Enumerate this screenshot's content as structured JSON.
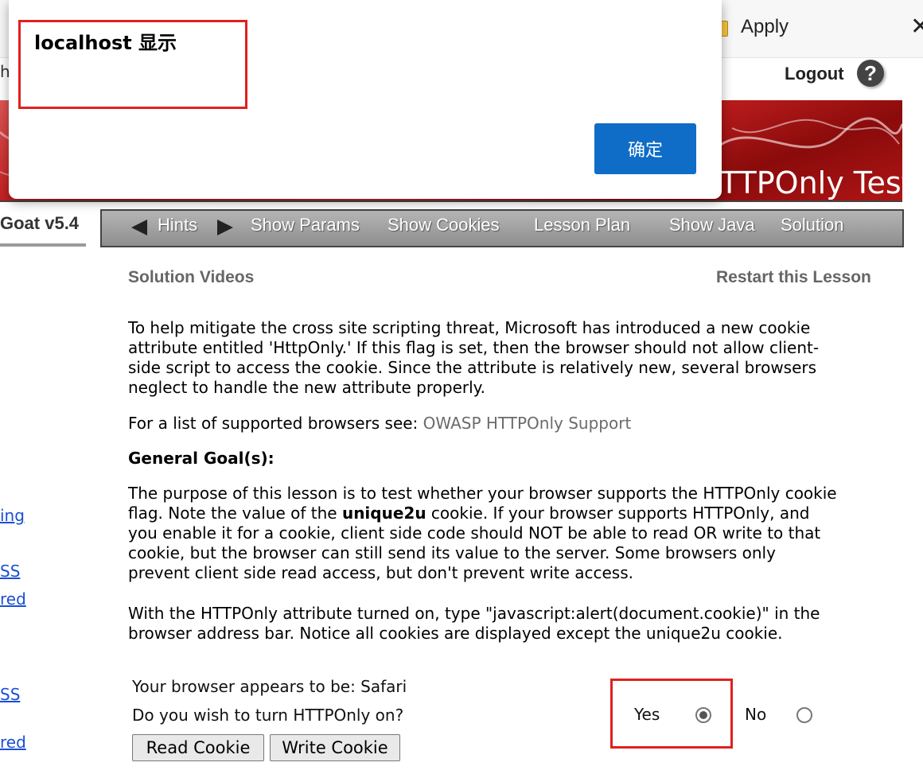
{
  "browser": {
    "apply_label": "Apply",
    "close_glyph": "✕"
  },
  "partial_left_text": "ho",
  "header": {
    "logout_label": "Logout",
    "help_glyph": "?"
  },
  "banner": {
    "title": "TTPOnly Test"
  },
  "brand": "Goat  v5.4",
  "nav": {
    "hints": "Hints",
    "show_params": "Show Params",
    "show_cookies": "Show Cookies",
    "lesson_plan": "Lesson Plan",
    "show_java": "Show Java",
    "solution": "Solution"
  },
  "links": {
    "solution_videos": "Solution Videos",
    "restart": "Restart this Lesson"
  },
  "content": {
    "intro_lines": [
      "To help mitigate the cross site scripting threat, Microsoft has introduced a new cookie",
      "attribute entitled 'HttpOnly.' If this flag is set, then the browser should not allow client-",
      "side script to access the cookie. Since the attribute is relatively new, several browsers",
      "neglect to handle the new attribute properly."
    ],
    "supported_prefix": "For a list of supported browsers see: ",
    "supported_link": "OWASP HTTPOnly Support",
    "goal_heading": "General Goal(s):",
    "purpose_line1": "The purpose of this lesson is to test whether your browser supports the HTTPOnly cookie",
    "purpose_line2_a": "flag. Note the value of the ",
    "purpose_line2_bold": "unique2u",
    "purpose_line2_b": " cookie. If your browser supports HTTPOnly, and",
    "purpose_rest": [
      "you enable it for a cookie, client side code should NOT be able to read OR write to that",
      "cookie, but the browser can still send its value to the server. Some browsers only",
      "prevent client side read access, but don't prevent write access."
    ],
    "httponly_lines": [
      "With the HTTPOnly attribute turned on, type \"javascript:alert(document.cookie)\" in the",
      "browser address bar. Notice all cookies are displayed except the unique2u cookie."
    ]
  },
  "left_fragments": [
    "ing",
    "SS",
    "red",
    "SS",
    "red"
  ],
  "form": {
    "browser_text": "Your browser appears to be: Safari",
    "question": "Do you wish to turn HTTPOnly on?",
    "yes_label": "Yes",
    "no_label": "No",
    "httponly_on": true,
    "read_cookie": "Read Cookie",
    "write_cookie": "Write Cookie"
  },
  "dialog": {
    "title": "localhost 显示",
    "ok_label": "确定"
  },
  "colors": {
    "banner_red": "#b11111",
    "ok_blue": "#0f6cc7",
    "highlight_red": "#e02020",
    "link_blue": "#1a4fd6"
  }
}
